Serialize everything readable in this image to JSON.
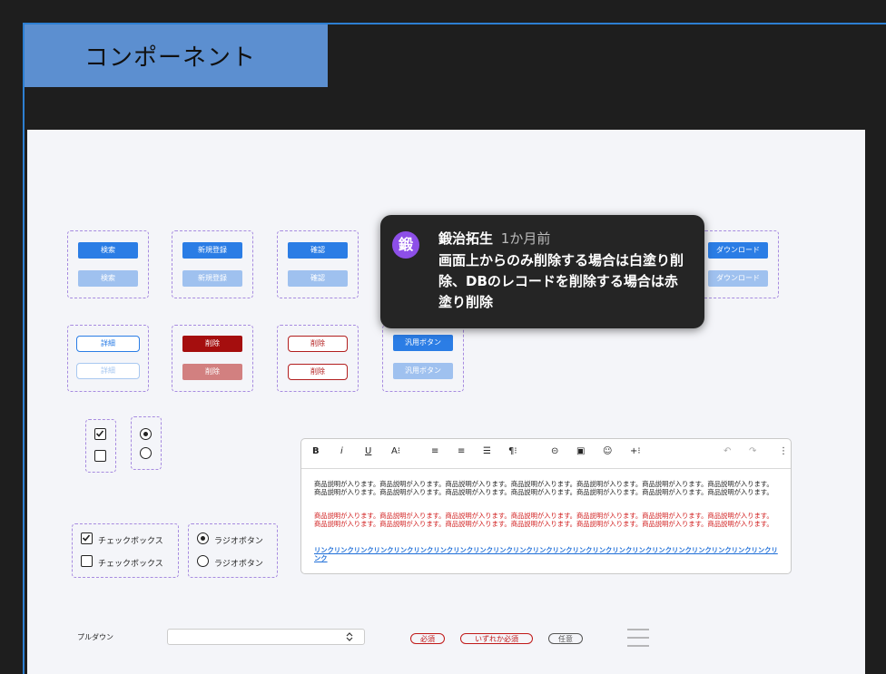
{
  "header": {
    "title": "コンポーネント"
  },
  "buttons": {
    "search": "検索",
    "new_register": "新規登録",
    "confirm": "確認",
    "download": "ダウンロード",
    "detail": "詳細",
    "delete": "削除",
    "general": "汎用ボタン"
  },
  "checks": {
    "checkbox_label": "チェックボックス",
    "radio_label": "ラジオボタン"
  },
  "editor": {
    "toolbar": [
      "B",
      "i",
      "U",
      "A⁝",
      "≡",
      "≡",
      "☰",
      "¶⁝",
      "⊝",
      "▣",
      "☺",
      "+⁝",
      "↶",
      "↷",
      "⋮"
    ],
    "text_black": "商品説明が入ります。商品説明が入ります。商品説明が入ります。商品説明が入ります。商品説明が入ります。商品説明が入ります。商品説明が入ります。商品説明が入ります。商品説明が入ります。商品説明が入ります。商品説明が入ります。商品説明が入ります。商品説明が入ります。商品説明が入ります。",
    "text_red": "商品説明が入ります。商品説明が入ります。商品説明が入ります。商品説明が入ります。商品説明が入ります。商品説明が入ります。商品説明が入ります。商品説明が入ります。商品説明が入ります。商品説明が入ります。商品説明が入ります。商品説明が入ります。商品説明が入ります。商品説明が入ります。",
    "text_link": "リンクリンクリンクリンクリンクリンクリンクリンクリンクリンクリンクリンクリンクリンクリンクリンクリンクリンクリンクリンクリンクリンクリンクリンク"
  },
  "comment": {
    "author": "鍛治拓生",
    "time": "1か月前",
    "avatar_char": "鍛",
    "body": "画面上からのみ削除する場合は白塗り削除、DBのレコードを削除する場合は赤塗り削除"
  },
  "form": {
    "dropdown_label": "プルダウン",
    "required": "必須",
    "either_required": "いずれか必須",
    "optional": "任意"
  },
  "colors": {
    "primary": "#2b7de5",
    "danger": "#a50e0e",
    "header_bg": "#5c8fd0",
    "avatar": "#8d4fe8"
  }
}
